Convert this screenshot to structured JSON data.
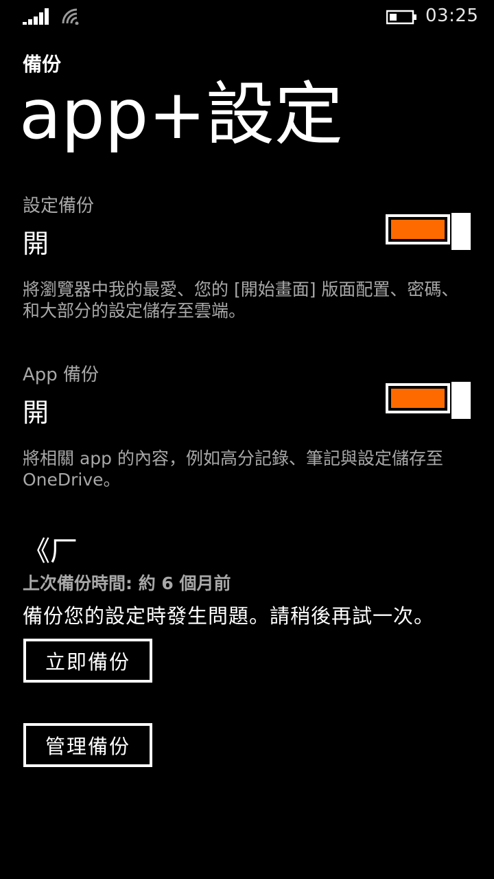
{
  "status_bar": {
    "time": "03:25",
    "icons": [
      "signal-icon",
      "wifi-icon",
      "battery-icon"
    ]
  },
  "header": {
    "app_name": "備份",
    "page_title": "app+設定"
  },
  "settings_backup": {
    "label": "設定備份",
    "state": "開",
    "toggle_on": true,
    "description": "將瀏覽器中我的最愛、您的 [開始畫面] 版面配置、密碼、和大部分的設定儲存至雲端。"
  },
  "app_backup": {
    "label": "App 備份",
    "state": "開",
    "toggle_on": true,
    "description": "將相關 app 的內容，例如高分記錄、筆記與設定儲存至 OneDrive。"
  },
  "backup_status": {
    "icon": "《厂",
    "last_backup": "上次備份時間: 約 6 個月前",
    "error": "備份您的設定時發生問題。請稍後再試一次。"
  },
  "buttons": {
    "backup_now": "立即備份",
    "manage_backup": "管理備份"
  },
  "colors": {
    "accent": "#ff6a00",
    "background": "#000000",
    "secondary_text": "#a8a8a8"
  }
}
